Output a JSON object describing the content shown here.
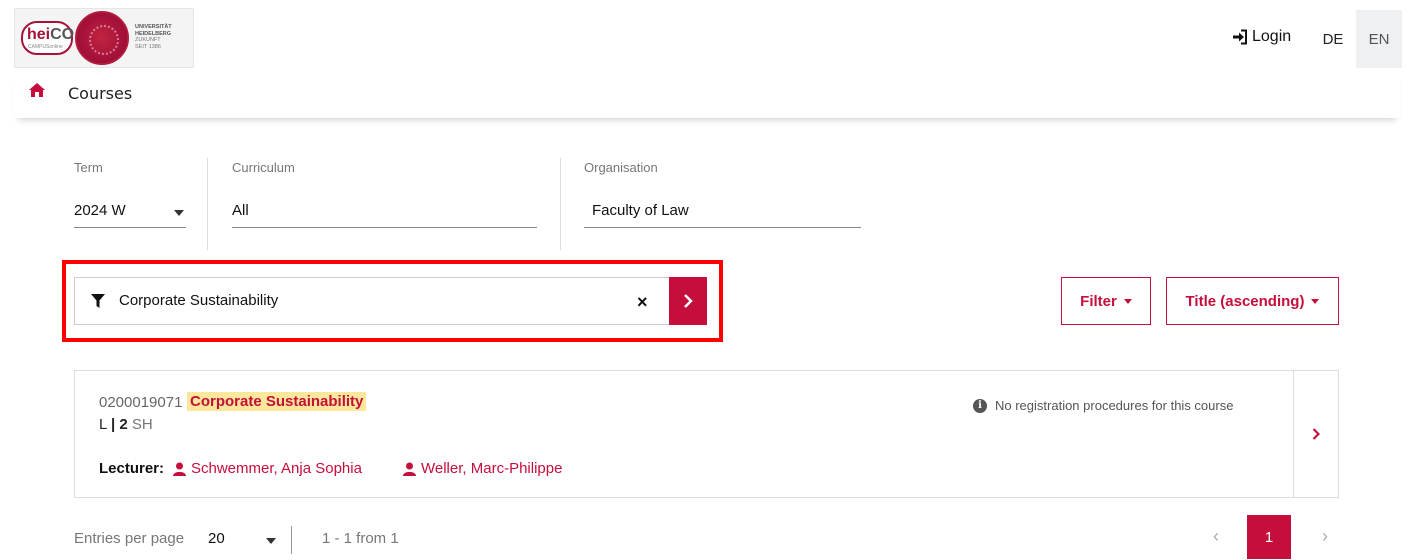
{
  "header": {
    "logo": {
      "brand_hei": "hei",
      "brand_co": "CO",
      "brand_sub": "CAMPUSonline",
      "university_line1": "UNIVERSITÄT",
      "university_line2": "HEIDELBERG",
      "university_line3": "ZUKUNFT",
      "university_line4": "SEIT 1386"
    },
    "login_label": "Login",
    "languages": [
      "DE",
      "EN"
    ],
    "active_language": "EN"
  },
  "breadcrumb": {
    "home_icon": "home-icon",
    "current": "Courses"
  },
  "filters": {
    "term": {
      "label": "Term",
      "value": "2024 W"
    },
    "curriculum": {
      "label": "Curriculum",
      "value": "All"
    },
    "organisation": {
      "label": "Organisation",
      "value": "Faculty of Law"
    }
  },
  "search": {
    "value": "Corporate Sustainability",
    "clear_symbol": "×"
  },
  "toolbar": {
    "filter_label": "Filter",
    "sort_label": "Title (ascending)"
  },
  "course": {
    "number": "0200019071",
    "title": "Corporate Sustainability",
    "type": "L",
    "separator": "|",
    "hours": "2",
    "hours_unit": "SH",
    "registration_note": "No registration procedures for this course",
    "lecturer_label": "Lecturer:",
    "lecturers": [
      "Schwemmer, Anja Sophia",
      "Weller, Marc-Philippe"
    ]
  },
  "pagination": {
    "entries_label": "Entries per page",
    "entries_value": "20",
    "range": "1 - 1 from 1",
    "prev": "‹",
    "current_page": "1",
    "next": "›"
  },
  "colors": {
    "accent": "#c50e3c",
    "highlight": "#fde79b",
    "annotation_frame": "#ff0000"
  }
}
